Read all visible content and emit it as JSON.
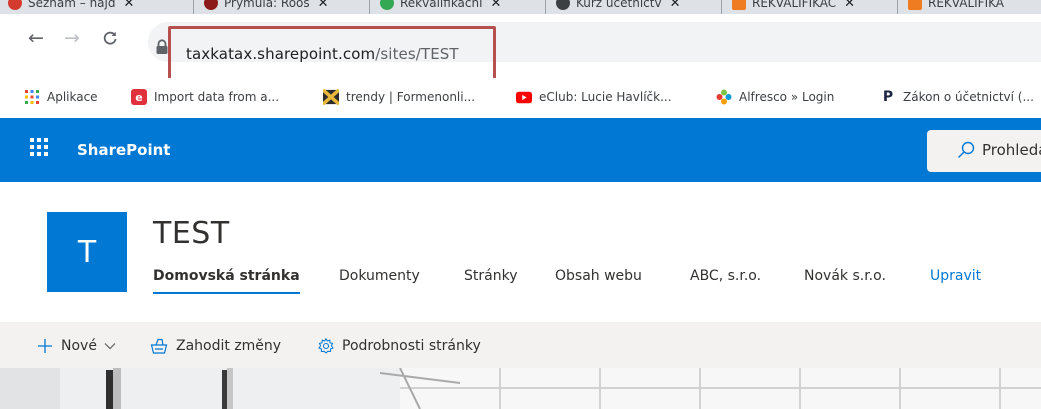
{
  "browser": {
    "tabs": [
      {
        "title": "Seznam – najd",
        "icon_color": "#d23b2e"
      },
      {
        "title": "Prymula: Roos",
        "icon_color": "#8b1a1a"
      },
      {
        "title": "Rekvalifikační",
        "icon_color": "#34a853"
      },
      {
        "title": "Kurz účetnictv",
        "icon_color": "#3c4043"
      },
      {
        "title": "REKVALIFIKAC",
        "icon_color": "#f07c21"
      },
      {
        "title": "REKVALIFIKA",
        "icon_color": "#f07c21"
      }
    ],
    "url_main": "taxkatax.sharepoint.com",
    "url_path": "/sites/TEST",
    "highlight_color": "#b5504f",
    "bookmarks": [
      {
        "label": "Aplikace",
        "icon": "apps-grid-icon"
      },
      {
        "label": "Import data from a...",
        "icon": "e-icon"
      },
      {
        "label": "trendy | Formenonli...",
        "icon": "trendy-icon"
      },
      {
        "label": "eClub: Lucie Havlíčk...",
        "icon": "youtube-icon"
      },
      {
        "label": "Alfresco » Login",
        "icon": "alfresco-icon"
      },
      {
        "label": "Zákon o účetnictví (...",
        "icon": "p-icon"
      }
    ]
  },
  "suite": {
    "app_name": "SharePoint",
    "search_placeholder": "Prohledat",
    "accent": "#0078d4"
  },
  "site": {
    "logo_letter": "T",
    "title": "TEST",
    "nav": [
      {
        "label": "Domovská stránka",
        "active": true
      },
      {
        "label": "Dokumenty"
      },
      {
        "label": "Stránky"
      },
      {
        "label": "Obsah webu"
      },
      {
        "label": "ABC, s.r.o."
      },
      {
        "label": "Novák s.r.o."
      },
      {
        "label": "Upravit",
        "link": true
      }
    ]
  },
  "commands": {
    "new_label": "Nové",
    "discard_label": "Zahodit změny",
    "details_label": "Podrobnosti stránky"
  }
}
